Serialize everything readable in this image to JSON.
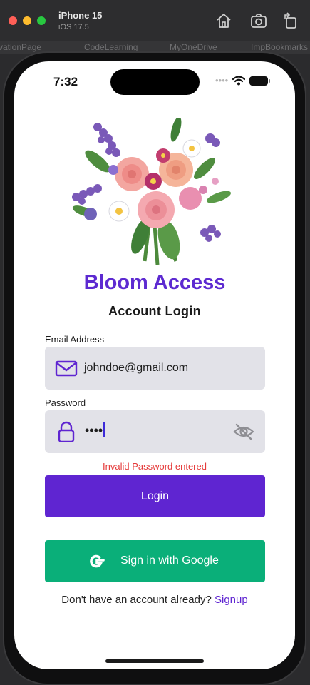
{
  "simulator": {
    "device_name": "iPhone 15",
    "os_version": "iOS 17.5",
    "background_bookmarks": [
      "vationPage",
      "CodeLearning",
      "MyOneDrive",
      "ImpBookmarks"
    ]
  },
  "status_bar": {
    "time": "7:32",
    "signal_dots": "••••"
  },
  "app": {
    "title": "Bloom Access",
    "subtitle": "Account Login",
    "brand_color": "#5f25d1"
  },
  "form": {
    "email_label": "Email Address",
    "email_value": "johndoe@gmail.com",
    "password_label": "Password",
    "password_masked": "••••",
    "error_message": "Invalid Password entered",
    "login_button": "Login",
    "google_button": "Sign in with Google",
    "signup_prompt": "Don't have an account already?",
    "signup_link": "Signup"
  },
  "icons": {
    "email": "envelope-icon",
    "password": "lock-icon",
    "visibility": "eye-slash-icon",
    "google": "google-g-icon"
  },
  "colors": {
    "error": "#e53b3b",
    "google_button": "#0aaf79",
    "field_background": "#e2e2e8"
  }
}
